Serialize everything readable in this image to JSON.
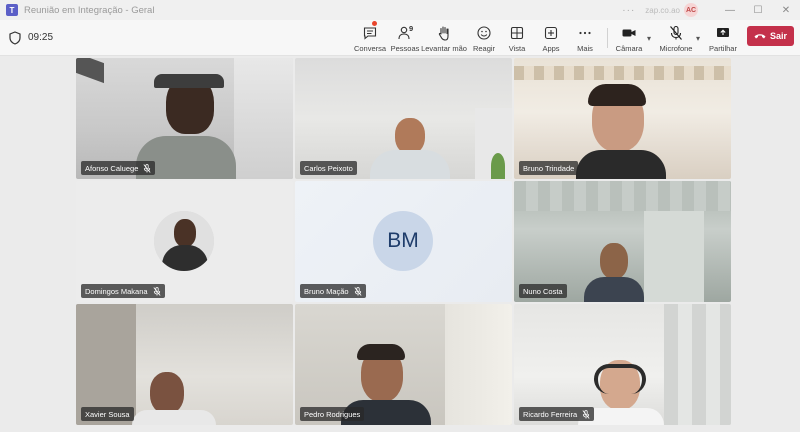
{
  "window": {
    "title": "Reunião em Integração - Geral",
    "dots": "···",
    "user_name": "zap.co.ao",
    "avatar_initials": "AC",
    "minimize": "—",
    "maximize": "☐",
    "close": "✕"
  },
  "toolbar": {
    "timer": "09:25",
    "buttons": {
      "chat": "Conversa",
      "people": "Pessoas",
      "people_count": "9",
      "raise_hand": "Levantar mão",
      "react": "Reagir",
      "view": "Vista",
      "apps": "Apps",
      "more": "Mais",
      "camera": "Câmara",
      "mic": "Microfone",
      "share": "Partilhar",
      "leave": "Sair"
    },
    "chevron": "▾"
  },
  "participants": [
    {
      "name": "Afonso Caluege",
      "muted": true
    },
    {
      "name": "Carlos Peixoto",
      "muted": false
    },
    {
      "name": "Bruno Trindade",
      "muted": false
    },
    {
      "name": "Domingos Makana",
      "muted": true
    },
    {
      "name": "Bruno Mação",
      "muted": true,
      "initials": "BM"
    },
    {
      "name": "Nuno Costa",
      "muted": false
    },
    {
      "name": "Xavier Sousa",
      "muted": false
    },
    {
      "name": "Pedro Rodrigues",
      "muted": false
    },
    {
      "name": "Ricardo Ferreira",
      "muted": true
    }
  ],
  "colors": {
    "accent": "#5b5fc7",
    "leave": "#c4314b",
    "notification": "#e8452c"
  }
}
